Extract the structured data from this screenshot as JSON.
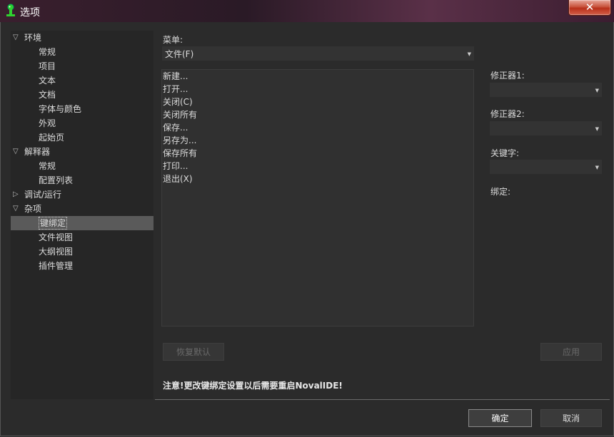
{
  "window": {
    "title": "选项",
    "close_glyph": "✕"
  },
  "tree": {
    "items": [
      {
        "label": "环境",
        "expander": "▽"
      },
      {
        "label": "常规"
      },
      {
        "label": "项目"
      },
      {
        "label": "文本"
      },
      {
        "label": "文档"
      },
      {
        "label": "字体与颜色"
      },
      {
        "label": "外观"
      },
      {
        "label": "起始页"
      },
      {
        "label": "解释器",
        "expander": "▽"
      },
      {
        "label": "常规"
      },
      {
        "label": "配置列表"
      },
      {
        "label": "调试/运行",
        "expander": "▷"
      },
      {
        "label": "杂项",
        "expander": "▽"
      },
      {
        "label": "键绑定",
        "selected": true
      },
      {
        "label": "文件视图"
      },
      {
        "label": "大纲视图"
      },
      {
        "label": "插件管理"
      }
    ]
  },
  "menu": {
    "label": "菜单:",
    "value": "文件(F)"
  },
  "commands": [
    "新建...",
    "打开...",
    "关闭(C)",
    "关闭所有",
    "保存...",
    "另存为...",
    "保存所有",
    "打印...",
    "退出(X)"
  ],
  "modifier1": {
    "label": "修正器1:",
    "value": ""
  },
  "modifier2": {
    "label": "修正器2:",
    "value": ""
  },
  "keyword": {
    "label": "关键字:",
    "value": ""
  },
  "binding": {
    "label": "绑定:"
  },
  "buttons": {
    "restore_default": "恢复默认",
    "apply": "应用",
    "ok": "确定",
    "cancel": "取消"
  },
  "notice": "注意!更改键绑定设置以后需要重启NovalIDE!",
  "colors": {
    "selected_bg": "#5a5a5a",
    "panel_bg": "#262626",
    "window_bg": "#2b2b2b"
  }
}
